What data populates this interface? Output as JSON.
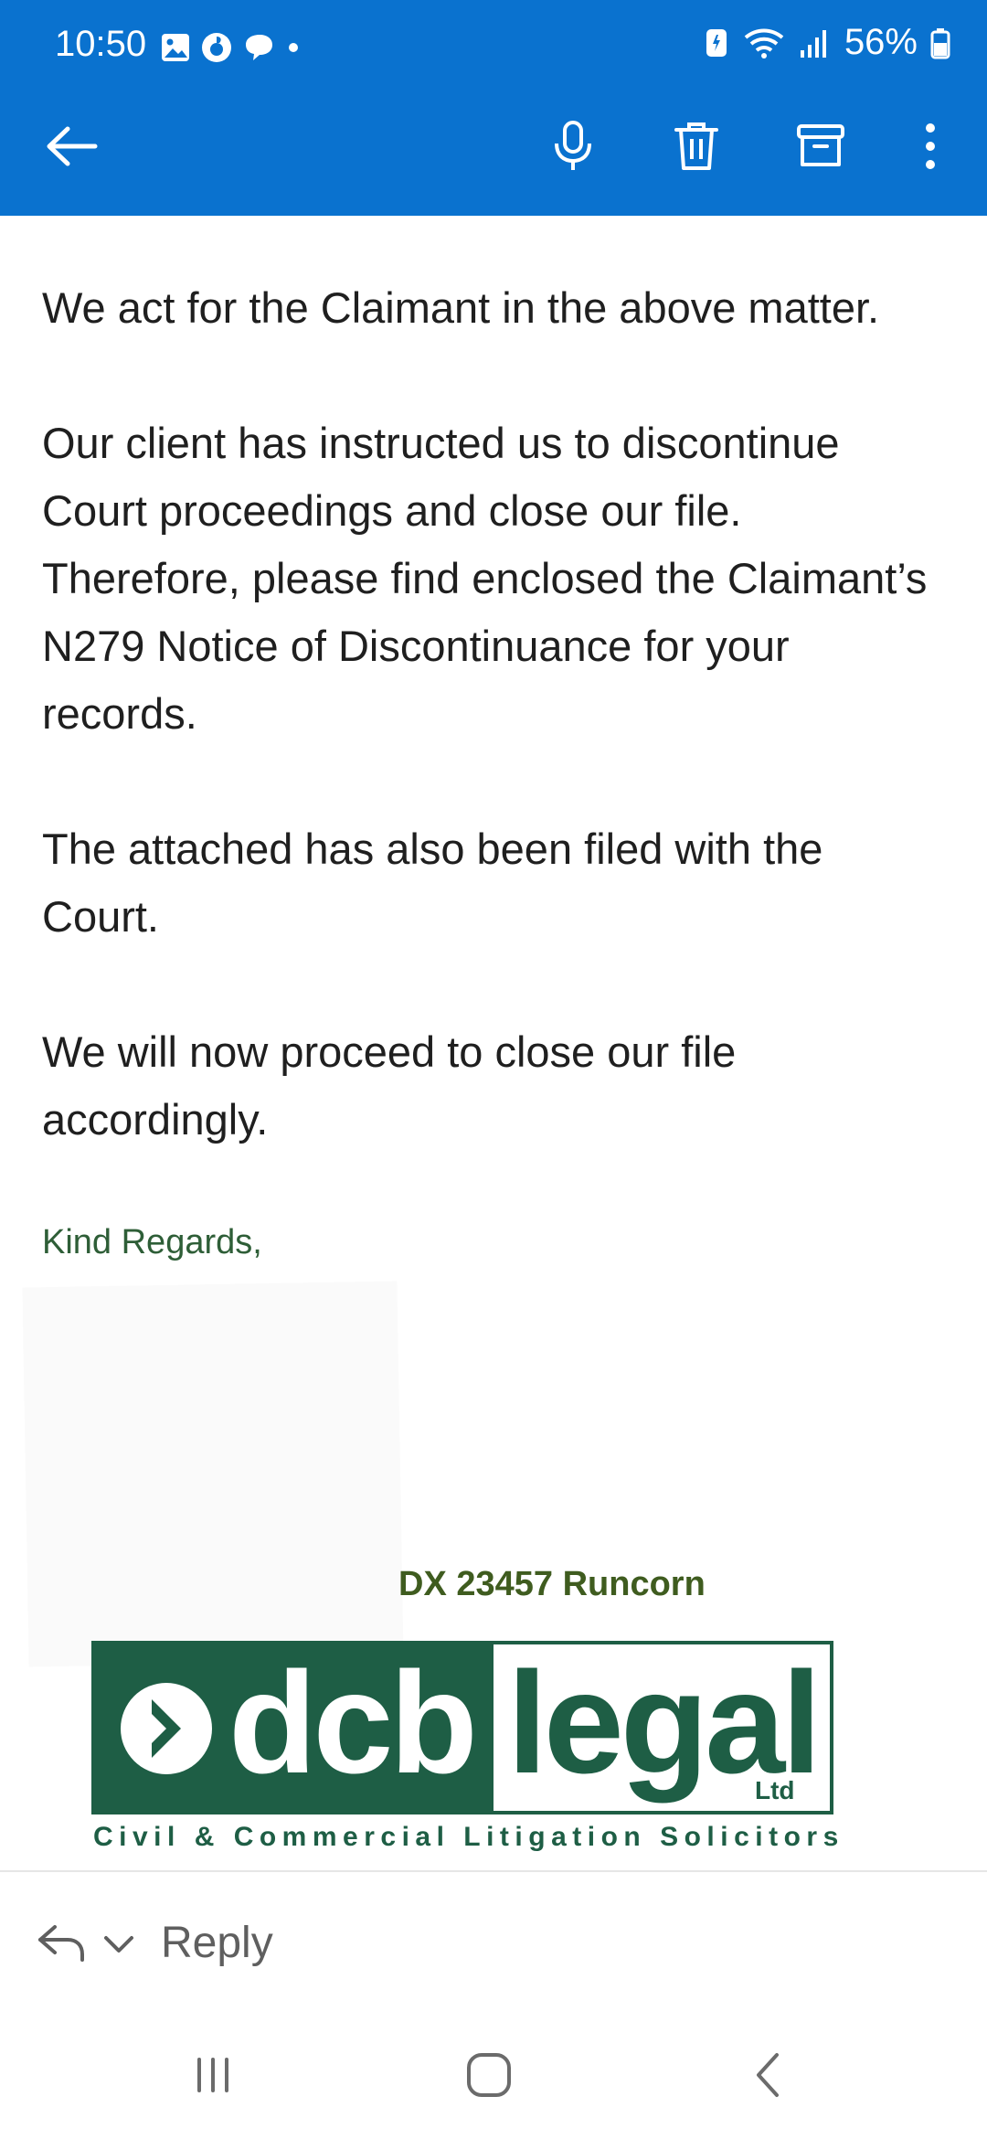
{
  "status_bar": {
    "time": "10:50",
    "battery": "56%"
  },
  "toolbar": {
    "back_icon": "arrow-left",
    "mic_icon": "microphone",
    "delete_icon": "trash",
    "archive_icon": "archive",
    "more_icon": "more-vertical"
  },
  "email": {
    "paragraphs": [
      "We act for the Claimant in the above matter.",
      "Our client has instructed us to discontinue Court proceedings and close our file. Therefore, please find enclosed the Claimant’s N279 Notice of Discontinuance for your records.",
      "The attached has also been filed with the Court.",
      "We will now proceed to close our file accordingly."
    ],
    "regards": "Kind Regards,",
    "dx": "DX 23457 Runcorn",
    "logo": {
      "dcb": "dcb",
      "legal": "legal",
      "ltd": "Ltd",
      "tagline": "Civil & Commercial Litigation Solicitors"
    }
  },
  "reply_bar": {
    "label": "Reply"
  },
  "colors": {
    "topbar": "#0A72CF",
    "logo_green": "#1E5E45",
    "regards_green": "#2E5E37"
  }
}
